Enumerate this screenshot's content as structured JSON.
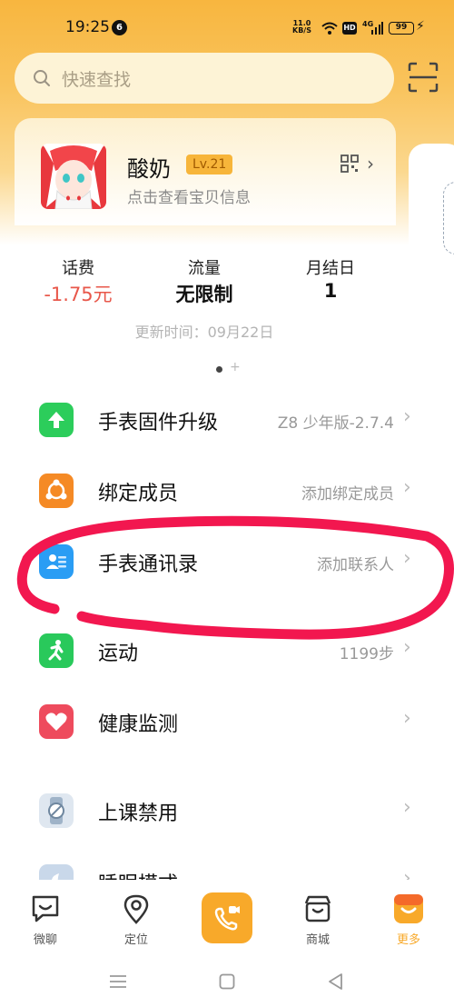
{
  "status_bar": {
    "time": "19:25",
    "notification_count": "6",
    "net_speed_value": "11.0",
    "net_speed_unit": "KB/S",
    "hd_label": "HD",
    "cell_label": "4G",
    "battery": "99"
  },
  "search": {
    "placeholder": "快速查找"
  },
  "profile": {
    "name": "酸奶",
    "level": "Lv.21",
    "subtitle": "点击查看宝贝信息"
  },
  "stats": [
    {
      "label": "话费",
      "value": "-1.75元",
      "color": "#e8574a"
    },
    {
      "label": "流量",
      "value": "无限制",
      "color": "#111111"
    },
    {
      "label": "月结日",
      "value": "1",
      "color": "#111111"
    }
  ],
  "update_time": "更新时间：09月22日",
  "menu": [
    {
      "label": "手表固件升级",
      "value": "Z8 少年版-2.7.4",
      "icon": "upgrade-arrow-icon",
      "color": "#2ccd5b"
    },
    {
      "label": "绑定成员",
      "value": "添加绑定成员",
      "icon": "share-members-icon",
      "color": "#f58a25"
    },
    {
      "label": "手表通讯录",
      "value": "添加联系人",
      "icon": "contacts-card-icon",
      "color": "#2a9df4"
    },
    {
      "label": "运动",
      "value": "1199步",
      "icon": "running-person-icon",
      "color": "#29c95b"
    },
    {
      "label": "健康监测",
      "value": "",
      "icon": "heart-icon",
      "color": "#ee4b5d"
    },
    {
      "label": "上课禁用",
      "value": "",
      "icon": "watch-disable-icon",
      "color": "#9fb3c8"
    },
    {
      "label": "睡眠模式",
      "value": "",
      "icon": "moon-icon",
      "color": "#7f9ec4"
    }
  ],
  "bottom_nav": {
    "items": [
      {
        "label": "微聊",
        "icon": "chat-icon"
      },
      {
        "label": "定位",
        "icon": "location-pin-icon"
      },
      {
        "label": "",
        "icon": "video-call-icon"
      },
      {
        "label": "商城",
        "icon": "store-icon"
      },
      {
        "label": "更多",
        "icon": "more-smile-icon"
      }
    ]
  },
  "colors": {
    "accent": "#f8a92a",
    "annotation": "#f2174f",
    "negative": "#e8574a"
  }
}
